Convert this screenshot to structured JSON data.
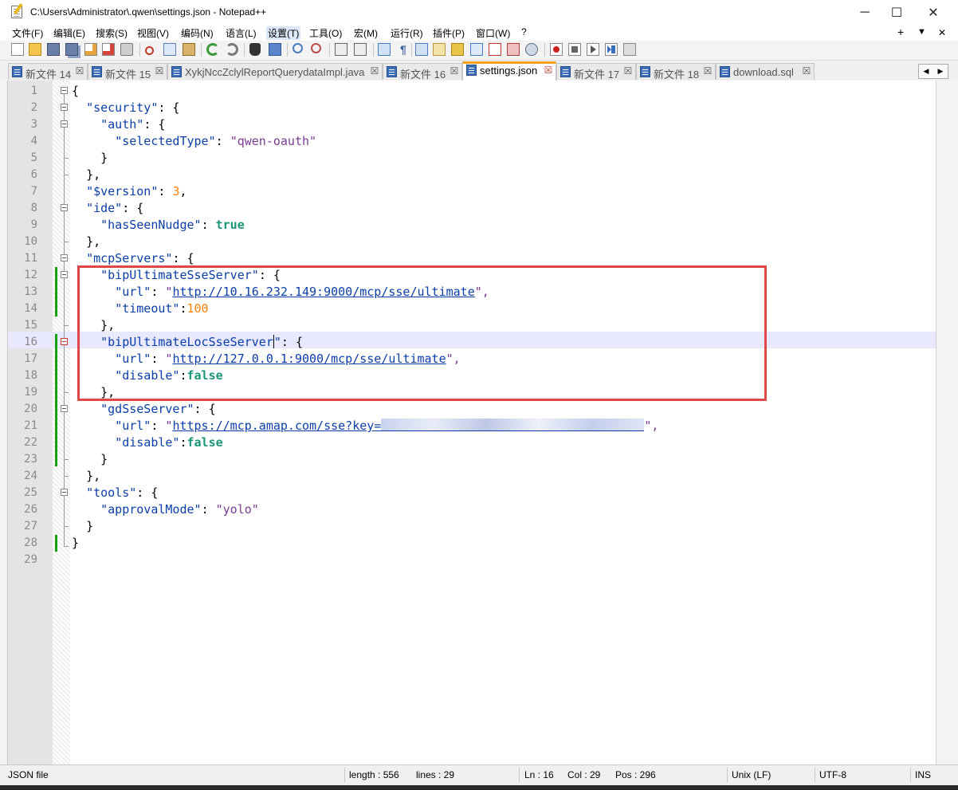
{
  "window": {
    "title": "C:\\Users\\Administrator\\.qwen\\settings.json - Notepad++",
    "minimize": "─",
    "maximize": "☐",
    "close": "✕"
  },
  "menu": {
    "items": [
      "文件(F)",
      "编辑(E)",
      "搜索(S)",
      "视图(V)",
      "编码(N)",
      "语言(L)",
      "设置(T)",
      "工具(O)",
      "宏(M)",
      "运行(R)",
      "插件(P)",
      "窗口(W)",
      "?"
    ],
    "plus": "+",
    "dropdown": "▼",
    "close": "✕"
  },
  "tabs": [
    {
      "label": "新文件 14",
      "active": false
    },
    {
      "label": "新文件 15",
      "active": false
    },
    {
      "label": "XykjNccZclylReportQuerydataImpl.java",
      "active": false
    },
    {
      "label": "新文件 16",
      "active": false
    },
    {
      "label": "settings.json",
      "active": true
    },
    {
      "label": "新文件 17",
      "active": false
    },
    {
      "label": "新文件 18",
      "active": false
    },
    {
      "label": "download.sql",
      "active": false
    }
  ],
  "tab_scroll": {
    "left": "◀",
    "right": "▶"
  },
  "editor": {
    "line_numbers": [
      "1",
      "2",
      "3",
      "4",
      "5",
      "6",
      "7",
      "8",
      "9",
      "10",
      "11",
      "12",
      "13",
      "14",
      "15",
      "16",
      "17",
      "18",
      "19",
      "20",
      "21",
      "22",
      "23",
      "24",
      "25",
      "26",
      "27",
      "28",
      "29"
    ],
    "current_line": 16,
    "tokens": {
      "l1": "{",
      "l2k": "\"security\"",
      "l2r": ": {",
      "l3k": "\"auth\"",
      "l3r": ": {",
      "l4k": "\"selectedType\"",
      "l4c": ": ",
      "l4v": "\"qwen-oauth\"",
      "l5": "}",
      "l6": "},",
      "l7k": "\"$version\"",
      "l7c": ": ",
      "l7v": "3",
      "l7r": ",",
      "l8k": "\"ide\"",
      "l8r": ": {",
      "l9k": "\"hasSeenNudge\"",
      "l9c": ": ",
      "l9v": "true",
      "l10": "},",
      "l11k": "\"mcpServers\"",
      "l11r": ": {",
      "l12k": "\"bipUltimateSseServer\"",
      "l12r": ": {",
      "l13k": "\"url\"",
      "l13c": ": ",
      "l13q1": "\"",
      "l13v": "http://10.16.232.149:9000/mcp/sse/ultimate",
      "l13q2": "\",",
      "l14k": "\"timeout\"",
      "l14c": ":",
      "l14v": "100",
      "l15": "},",
      "l16k": "\"bipUltimateLocSseServer",
      "l16k2": "\"",
      "l16r": ": {",
      "l17k": "\"url\"",
      "l17c": ": ",
      "l17q1": "\"",
      "l17v": "http://127.0.0.1:9000/mcp/sse/ultimate",
      "l17q2": "\",",
      "l18k": "\"disable\"",
      "l18c": ":",
      "l18v": "false",
      "l19": "},",
      "l20k": "\"gdSseServer\"",
      "l20r": ": {",
      "l21k": "\"url\"",
      "l21c": ": ",
      "l21q1": "\"",
      "l21v": "https://mcp.amap.com/sse?key=",
      "l21q2": "\",",
      "l22k": "\"disable\"",
      "l22c": ":",
      "l22v": "false",
      "l23": "}",
      "l24": "},",
      "l25k": "\"tools\"",
      "l25r": ": {",
      "l26k": "\"approvalMode\"",
      "l26c": ": ",
      "l26v": "\"yolo\"",
      "l27": "}",
      "l28": "}"
    }
  },
  "status": {
    "file_type": "JSON file",
    "length": "length : 556",
    "lines": "lines : 29",
    "ln": "Ln : 16",
    "col": "Col : 29",
    "pos": "Pos : 296",
    "eol": "Unix (LF)",
    "encoding": "UTF-8",
    "mode": "INS"
  },
  "colors": {
    "key": "#0b3ea8",
    "string": "#7a3b92",
    "number": "#ff8000",
    "keyword": "#1b9777",
    "highlight_box": "#e04848",
    "active_tab_accent": "#f7a21b",
    "change_marker": "#13a10e"
  },
  "icons": [
    "notepad-icon",
    "new-file-icon",
    "open-icon",
    "save-icon",
    "save-all-icon",
    "close-icon",
    "close-all-icon",
    "print-icon",
    "cut-icon",
    "copy-icon",
    "paste-icon",
    "undo-icon",
    "redo-icon",
    "find-icon",
    "replace-icon",
    "zoom-in-icon",
    "zoom-out-icon",
    "sync-vertical-icon",
    "sync-horizontal-icon",
    "word-wrap-icon",
    "show-all-chars-icon",
    "indent-guide-icon",
    "doc-map-icon",
    "function-list-icon",
    "folder-workspace-icon",
    "monitor-icon",
    "record-macro-icon",
    "stop-macro-icon",
    "play-macro-icon",
    "run-macro-multiple-icon",
    "save-macro-icon"
  ]
}
